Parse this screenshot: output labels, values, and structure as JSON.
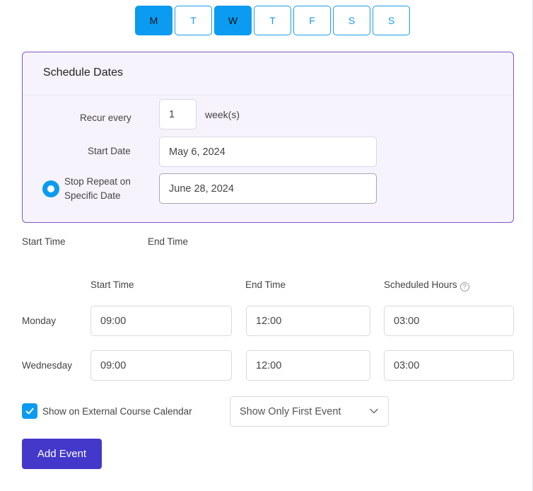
{
  "days": [
    {
      "label": "M",
      "active": true
    },
    {
      "label": "T",
      "active": false
    },
    {
      "label": "W",
      "active": true
    },
    {
      "label": "T",
      "active": false
    },
    {
      "label": "F",
      "active": false
    },
    {
      "label": "S",
      "active": false
    },
    {
      "label": "S",
      "active": false
    }
  ],
  "schedule": {
    "title": "Schedule Dates",
    "recur_label": "Recur every",
    "recur_value": "1",
    "recur_unit": "week(s)",
    "start_date_label": "Start Date",
    "start_date_value": "May 6, 2024",
    "stop_label_line1": "Stop Repeat on",
    "stop_label_line2": "Specific Date",
    "stop_date_value": "June 28, 2024"
  },
  "time_summary": {
    "start_time_label": "Start Time",
    "end_time_label": "End Time"
  },
  "table": {
    "headers": {
      "start": "Start Time",
      "end": "End Time",
      "hours": "Scheduled Hours",
      "help_icon": "?"
    },
    "rows": [
      {
        "day": "Monday",
        "start": "09:00",
        "end": "12:00",
        "hours": "03:00"
      },
      {
        "day": "Wednesday",
        "start": "09:00",
        "end": "12:00",
        "hours": "03:00"
      }
    ]
  },
  "calendar": {
    "checkbox_checked": true,
    "checkbox_label": "Show on External Course Calendar",
    "event_option": "Show Only First Event"
  },
  "actions": {
    "add_event_label": "Add Event"
  },
  "colors": {
    "accent_blue": "#0b9bf0",
    "panel_border": "#7e57c2",
    "button_primary": "#4338ca"
  }
}
